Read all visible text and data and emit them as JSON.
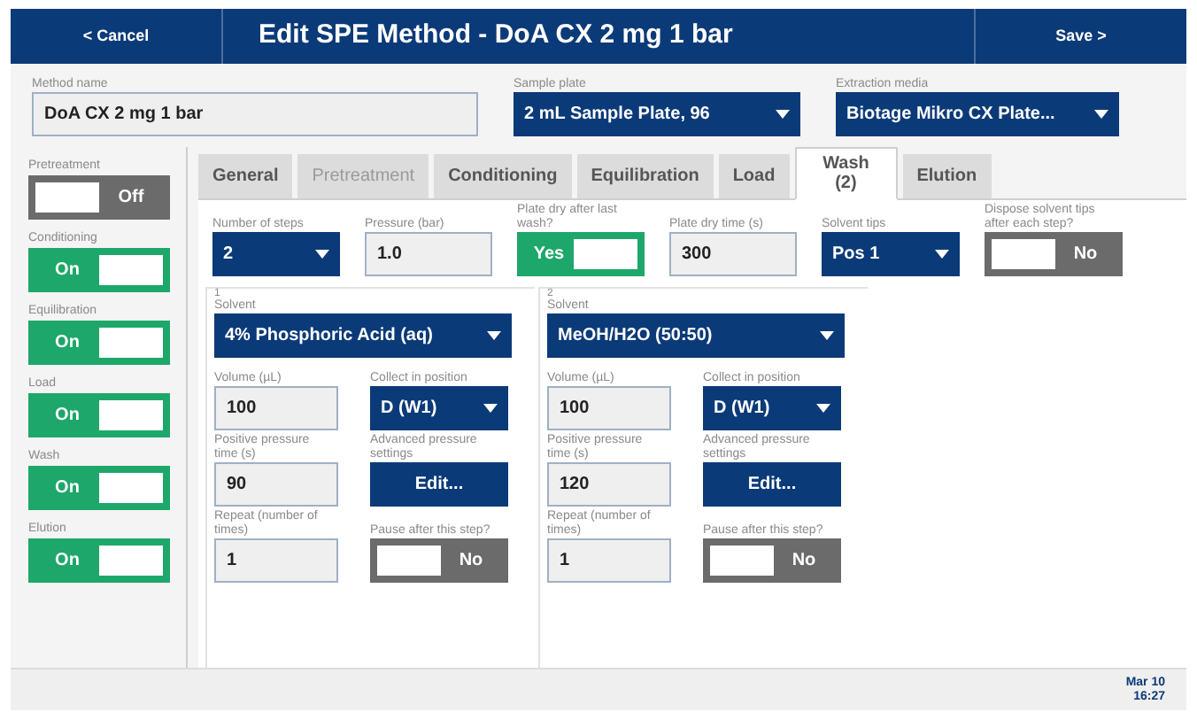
{
  "header": {
    "cancel": "< Cancel",
    "title": "Edit SPE Method - DoA CX 2 mg 1 bar",
    "save": "Save >"
  },
  "top_fields": [
    {
      "kind": "input",
      "label": "Method name",
      "value": "DoA CX 2 mg 1 bar"
    },
    {
      "kind": "dropdown",
      "label": "Sample plate",
      "value": "2 mL Sample Plate, 96"
    },
    {
      "kind": "dropdown",
      "label": "Extraction media",
      "value": "Biotage Mikro CX Plate..."
    }
  ],
  "sidebar": [
    {
      "label": "Pretreatment",
      "on": false,
      "text": "Off"
    },
    {
      "label": "Conditioning",
      "on": true,
      "text": "On"
    },
    {
      "label": "Equilibration",
      "on": true,
      "text": "On"
    },
    {
      "label": "Load",
      "on": true,
      "text": "On"
    },
    {
      "label": "Wash",
      "on": true,
      "text": "On"
    },
    {
      "label": "Elution",
      "on": true,
      "text": "On"
    }
  ],
  "tabs": [
    {
      "label": "General",
      "selected": false,
      "disabled": false
    },
    {
      "label": "Pretreatment",
      "selected": false,
      "disabled": true
    },
    {
      "label": "Conditioning",
      "selected": false,
      "disabled": false
    },
    {
      "label": "Equilibration",
      "selected": false,
      "disabled": false
    },
    {
      "label": "Load",
      "selected": false,
      "disabled": false
    },
    {
      "label": "Wash (2)",
      "selected": true,
      "disabled": false
    },
    {
      "label": "Elution",
      "selected": false,
      "disabled": false
    }
  ],
  "settings": [
    {
      "kind": "dropdown",
      "label": "Number of steps",
      "value": "2"
    },
    {
      "kind": "input",
      "label": "Pressure (bar)",
      "value": "1.0"
    },
    {
      "kind": "toggle",
      "label": "Plate dry after last wash?",
      "on": true,
      "text": "Yes"
    },
    {
      "kind": "input",
      "label": "Plate dry time (s)",
      "value": "300"
    },
    {
      "kind": "dropdown",
      "label": "Solvent tips",
      "value": "Pos 1"
    },
    {
      "kind": "toggle",
      "label": "Dispose solvent tips after each step?",
      "on": false,
      "text": "No"
    }
  ],
  "steps": [
    {
      "number": "1",
      "solvent_label": "Solvent",
      "solvent": "4% Phosphoric Acid (aq)",
      "fields": [
        {
          "kind": "input",
          "label": "Volume (µL)",
          "value": "100"
        },
        {
          "kind": "dropdown",
          "label": "Collect in position",
          "value": "D (W1)"
        },
        {
          "kind": "input",
          "label": "Positive pressure time (s)",
          "value": "90"
        },
        {
          "kind": "button",
          "label": "Advanced pressure settings",
          "value": "Edit..."
        },
        {
          "kind": "input",
          "label": "Repeat (number of times)",
          "value": "1"
        },
        {
          "kind": "toggle",
          "label": "Pause after this step?",
          "on": false,
          "text": "No"
        }
      ]
    },
    {
      "number": "2",
      "solvent_label": "Solvent",
      "solvent": "MeOH/H2O (50:50)",
      "fields": [
        {
          "kind": "input",
          "label": "Volume (µL)",
          "value": "100"
        },
        {
          "kind": "dropdown",
          "label": "Collect in position",
          "value": "D (W1)"
        },
        {
          "kind": "input",
          "label": "Positive pressure time (s)",
          "value": "120"
        },
        {
          "kind": "button",
          "label": "Advanced pressure settings",
          "value": "Edit..."
        },
        {
          "kind": "input",
          "label": "Repeat (number of times)",
          "value": "1"
        },
        {
          "kind": "toggle",
          "label": "Pause after this step?",
          "on": false,
          "text": "No"
        }
      ]
    }
  ],
  "status_bar": {
    "date": "Mar 10",
    "time": "16:27"
  }
}
